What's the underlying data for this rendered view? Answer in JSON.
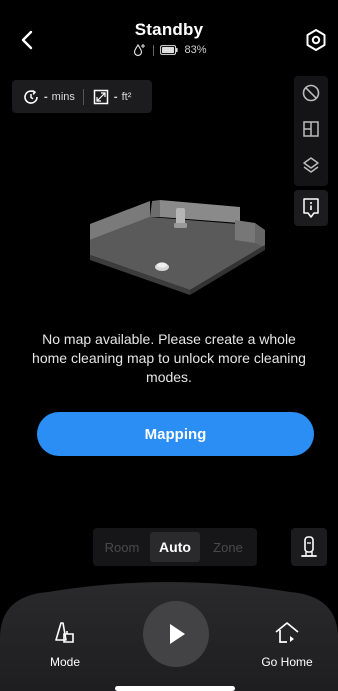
{
  "header": {
    "title": "Standby",
    "battery_percent": "83%",
    "back_icon": "chevron-left-icon",
    "settings_icon": "settings-ring-icon",
    "water_icon": "water-drop-icon",
    "battery_icon": "battery-icon",
    "battery_level": 0.83
  },
  "stats": {
    "time_value": "-",
    "time_unit": "mins",
    "area_value": "-",
    "area_unit": "ft²",
    "time_icon": "clock-refresh-icon",
    "area_icon": "area-frame-icon"
  },
  "rail": {
    "items": [
      {
        "name": "no-go-zone-icon"
      },
      {
        "name": "room-split-icon"
      },
      {
        "name": "layers-icon"
      }
    ],
    "info_icon": "info-icon"
  },
  "map": {
    "icon": "3d-room-map-placeholder"
  },
  "message": {
    "line1": "No map available. Please create a whole",
    "line2": "home cleaning map to unlock more cleaning",
    "line3": "modes."
  },
  "mapping_button": {
    "label": "Mapping"
  },
  "mode_selector": {
    "options": [
      "Room",
      "Auto",
      "Zone"
    ],
    "selected": "Auto"
  },
  "dock_icon": "robot-dock-icon",
  "bottom_bar": {
    "mode_label": "Mode",
    "go_home_label": "Go Home",
    "mode_icon": "mode-cleaner-icon",
    "play_icon": "play-icon",
    "go_home_icon": "go-home-icon"
  },
  "colors": {
    "accent": "#2a8ef4",
    "background": "#000000",
    "surface": "#1c1c1e"
  }
}
